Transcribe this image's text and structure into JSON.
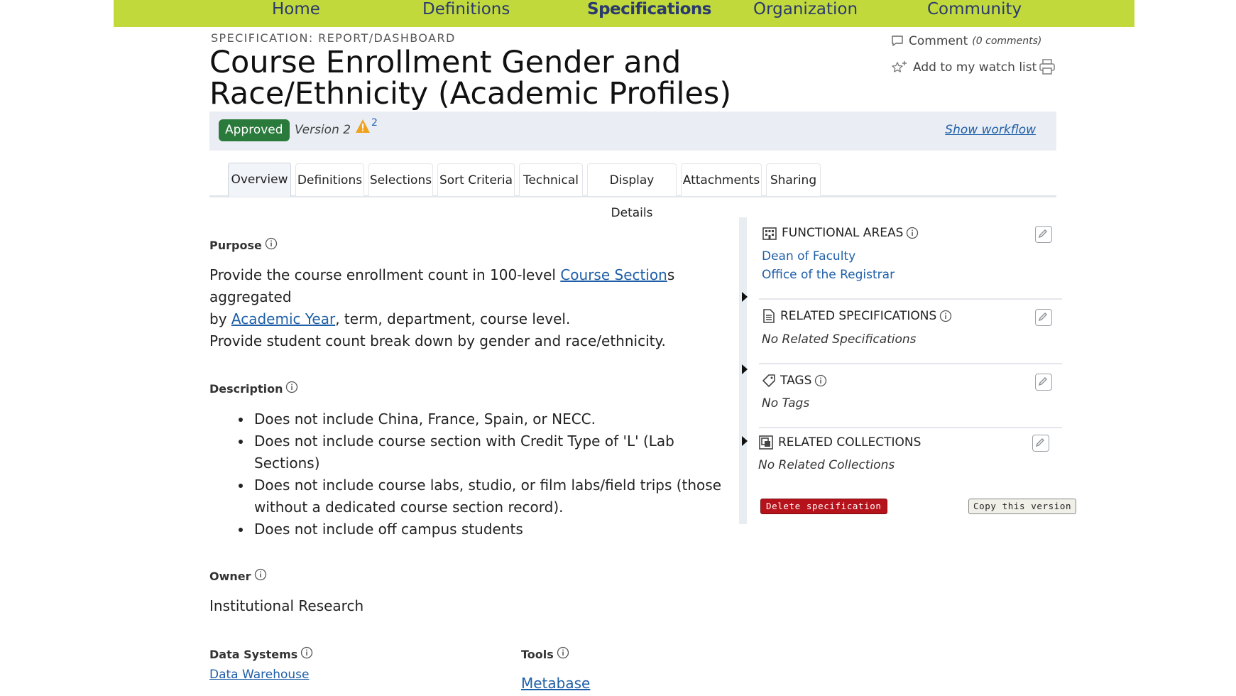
{
  "nav": {
    "items": [
      {
        "label": "Home",
        "active": false
      },
      {
        "label": "Definitions",
        "active": false
      },
      {
        "label": "Specifications",
        "active": true
      },
      {
        "label": "Organization",
        "active": false
      },
      {
        "label": "Community",
        "active": false
      }
    ]
  },
  "header": {
    "spec_type": "SPECIFICATION: REPORT/DASHBOARD",
    "title": "Course Enrollment Gender and Race/Ethnicity (Academic Profiles)",
    "comment_label": "Comment",
    "comment_count": "(0 comments)",
    "watch_label": "Add to my watch list"
  },
  "status": {
    "badge": "Approved",
    "version": "Version 2",
    "warning_count": "2",
    "workflow_link": "Show workflow"
  },
  "tabs": [
    {
      "label": "Overview",
      "active": true
    },
    {
      "label": "Definitions",
      "active": false
    },
    {
      "label": "Selections",
      "active": false
    },
    {
      "label": "Sort Criteria",
      "active": false
    },
    {
      "label": "Technical",
      "active": false
    },
    {
      "label": "Display Details",
      "active": false
    },
    {
      "label": "Attachments",
      "active": false
    },
    {
      "label": "Sharing",
      "active": false
    }
  ],
  "main": {
    "purpose": {
      "label": "Purpose",
      "line1_a": "Provide the course enrollment count in 100-level ",
      "line1_link": "Course Section",
      "line1_b": "s aggregated",
      "line2_a": "by ",
      "line2_link": "Academic Year",
      "line2_b": ", term, department, course level.",
      "line3": "Provide student count break down by gender and race/ethnicity."
    },
    "description": {
      "label": "Description",
      "items": [
        "Does not include China, France, Spain, or NECC.",
        "Does not include course section with Credit Type of 'L' (Lab Sections)",
        "Does not include course labs, studio, or film labs/field trips (those without a dedicated course section record).",
        "Does not include off campus students"
      ]
    },
    "owner": {
      "label": "Owner",
      "value": "Institutional Research"
    },
    "data_systems": {
      "label": "Data Systems",
      "value": "Data Warehouse"
    },
    "tools": {
      "label": "Tools",
      "value": "Metabase"
    }
  },
  "sidebar": {
    "functional_areas": {
      "label": "FUNCTIONAL AREAS",
      "items": [
        "Dean of Faculty",
        "Office of the Registrar"
      ]
    },
    "related_specs": {
      "label": "RELATED SPECIFICATIONS",
      "empty": "No Related Specifications"
    },
    "tags": {
      "label": "TAGS",
      "empty": "No Tags"
    },
    "related_collections": {
      "label": "RELATED COLLECTIONS",
      "empty": "No Related Collections"
    },
    "delete_label": "Delete specification",
    "copy_label": "Copy this version"
  },
  "colors": {
    "nav_bg": "#c2d93c",
    "nav_text": "#2a3a6e",
    "link": "#1f5fa8",
    "approved": "#2a7a3b",
    "delete": "#b5121b"
  }
}
